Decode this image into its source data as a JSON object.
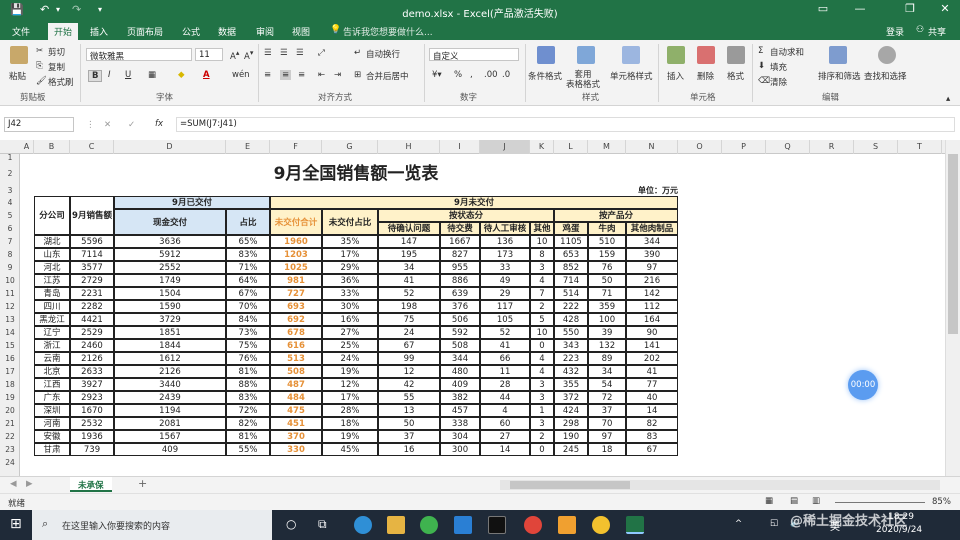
{
  "titlebar": {
    "file_title": "demo.xlsx - Excel(产品激活失败)",
    "minimize": "—",
    "restore": "❐",
    "close": "✕"
  },
  "tabs": [
    "文件",
    "开始",
    "插入",
    "页面布局",
    "公式",
    "数据",
    "审阅",
    "视图"
  ],
  "active_tab": "开始",
  "tell_me": "告诉我您想要做什么...",
  "login": "登录",
  "share": "共享",
  "ribbon": {
    "paste": "粘贴",
    "cut": "剪切",
    "copy": "复制",
    "format_painter": "格式刷",
    "clipboard": "剪贴板",
    "font_name": "微软雅黑",
    "font_size": "11",
    "font_group": "字体",
    "wrap_text": "自动换行",
    "merge_center": "合并后居中",
    "alignment": "对齐方式",
    "number_format": "自定义",
    "number": "数字",
    "conditional_format": "条件格式",
    "table_format": "套用\n表格格式",
    "cell_style": "单元格样式",
    "styles": "样式",
    "insert": "插入",
    "delete": "删除",
    "format": "格式",
    "cells": "单元格",
    "autosum": "自动求和",
    "fill": "填充",
    "clear": "清除",
    "sort_filter": "排序和筛选",
    "find_select": "查找和选择",
    "editing": "编辑",
    "bold": "B",
    "italic": "I",
    "underline": "U",
    "font_color": "A"
  },
  "formula_bar": {
    "name_box": "J42",
    "cancel": "✕",
    "enter": "✓",
    "fx": "fx",
    "formula": "=SUM(J7:J41)"
  },
  "columns": [
    "A",
    "B",
    "C",
    "D",
    "E",
    "F",
    "G",
    "H",
    "I",
    "J",
    "K",
    "L",
    "M",
    "N",
    "O",
    "P",
    "Q",
    "R",
    "S",
    "T"
  ],
  "rows": [
    "1",
    "2",
    "3",
    "4",
    "5",
    "6",
    "7",
    "8",
    "9",
    "10",
    "11",
    "12",
    "13",
    "14",
    "15",
    "16",
    "17",
    "18",
    "19",
    "20",
    "21",
    "22",
    "23",
    "24"
  ],
  "sheet": {
    "title": "9月全国销售额一览表",
    "unit": "单位：万元",
    "h_branch": "分公司",
    "h_sales": "9月销售额",
    "h_delivered": "9月已交付",
    "h_undelivered": "9月未交付",
    "h_cash": "现金交付",
    "h_ratio": "占比",
    "h_undel_total": "未交付合计",
    "h_undel_ratio": "未交付占比",
    "h_by_status": "按状态分",
    "h_by_product": "按产品分",
    "h_pending_q": "待确认问题",
    "h_pending_pay": "待交费",
    "h_pending_review": "待人工审核",
    "h_other": "其他",
    "h_egg": "鸡蛋",
    "h_beef": "牛肉",
    "h_other_meat": "其他肉制品",
    "data": [
      [
        "湖北",
        "5596",
        "3636",
        "65%",
        "1960",
        "35%",
        "147",
        "1667",
        "136",
        "10",
        "1105",
        "510",
        "344"
      ],
      [
        "山东",
        "7114",
        "5912",
        "83%",
        "1203",
        "17%",
        "195",
        "827",
        "173",
        "8",
        "653",
        "159",
        "390"
      ],
      [
        "河北",
        "3577",
        "2552",
        "71%",
        "1025",
        "29%",
        "34",
        "955",
        "33",
        "3",
        "852",
        "76",
        "97"
      ],
      [
        "江苏",
        "2729",
        "1749",
        "64%",
        "981",
        "36%",
        "41",
        "886",
        "49",
        "4",
        "714",
        "50",
        "216"
      ],
      [
        "青岛",
        "2231",
        "1504",
        "67%",
        "727",
        "33%",
        "52",
        "639",
        "29",
        "7",
        "514",
        "71",
        "142"
      ],
      [
        "四川",
        "2282",
        "1590",
        "70%",
        "693",
        "30%",
        "198",
        "376",
        "117",
        "2",
        "222",
        "359",
        "112"
      ],
      [
        "黑龙江",
        "4421",
        "3729",
        "84%",
        "692",
        "16%",
        "75",
        "506",
        "105",
        "5",
        "428",
        "100",
        "164"
      ],
      [
        "辽宁",
        "2529",
        "1851",
        "73%",
        "678",
        "27%",
        "24",
        "592",
        "52",
        "10",
        "550",
        "39",
        "90"
      ],
      [
        "浙江",
        "2460",
        "1844",
        "75%",
        "616",
        "25%",
        "67",
        "508",
        "41",
        "0",
        "343",
        "132",
        "141"
      ],
      [
        "云南",
        "2126",
        "1612",
        "76%",
        "513",
        "24%",
        "99",
        "344",
        "66",
        "4",
        "223",
        "89",
        "202"
      ],
      [
        "北京",
        "2633",
        "2126",
        "81%",
        "508",
        "19%",
        "12",
        "480",
        "11",
        "4",
        "432",
        "34",
        "41"
      ],
      [
        "江西",
        "3927",
        "3440",
        "88%",
        "487",
        "12%",
        "42",
        "409",
        "28",
        "3",
        "355",
        "54",
        "77"
      ],
      [
        "广东",
        "2923",
        "2439",
        "83%",
        "484",
        "17%",
        "55",
        "382",
        "44",
        "3",
        "372",
        "72",
        "40"
      ],
      [
        "深圳",
        "1670",
        "1194",
        "72%",
        "475",
        "28%",
        "13",
        "457",
        "4",
        "1",
        "424",
        "37",
        "14"
      ],
      [
        "河南",
        "2532",
        "2081",
        "82%",
        "451",
        "18%",
        "50",
        "338",
        "60",
        "3",
        "298",
        "70",
        "82"
      ],
      [
        "安徽",
        "1936",
        "1567",
        "81%",
        "370",
        "19%",
        "37",
        "304",
        "27",
        "2",
        "190",
        "97",
        "83"
      ],
      [
        "甘肃",
        "739",
        "409",
        "55%",
        "330",
        "45%",
        "16",
        "300",
        "14",
        "0",
        "245",
        "18",
        "67"
      ]
    ]
  },
  "timer": "00:00",
  "sheet_tab": "未承保",
  "add_sheet": "+",
  "status": {
    "ready": "就绪",
    "zoom": "85%"
  },
  "taskbar": {
    "search_placeholder": "在这里输入你要搜索的内容",
    "time": "18:29",
    "date": "2020/9/24",
    "ime": "英",
    "watermark": "@稀土掘金技术社区"
  }
}
